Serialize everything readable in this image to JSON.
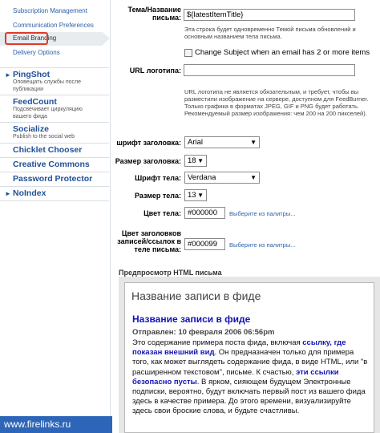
{
  "sidebar": {
    "sub_items": [
      {
        "label": "Subscription Management"
      },
      {
        "label": "Communication Preferences"
      },
      {
        "label": "Email Branding"
      },
      {
        "label": "Delivery Options"
      }
    ],
    "services": [
      {
        "title": "PingShot",
        "desc": "Оповещать службы после публикации"
      },
      {
        "title": "FeedCount",
        "desc": "Подсвечивает циркуляцию вашего фида"
      },
      {
        "title": "Socialize",
        "desc": "Publish to the social web"
      },
      {
        "title": "Chicklet Chooser",
        "desc": ""
      },
      {
        "title": "Creative Commons",
        "desc": ""
      },
      {
        "title": "Password Protector",
        "desc": ""
      },
      {
        "title": "NoIndex",
        "desc": ""
      }
    ]
  },
  "form": {
    "subject_label": "Тема/Название письма:",
    "subject_value": "${latestItemTitle}",
    "subject_help": "Эта строка будет одновременно Темой письма обновлений и основным названием тела письма.",
    "change_subject_label": "Change Subject when an email has 2 or more items",
    "logo_label": "URL логотипа:",
    "logo_value": "",
    "logo_help": "URL логотипа не является обязательным, и требует, чтобы вы разместили изображение на сервере, доступном для FeedBurner. Только графика в форматах JPEG, GIF и PNG будет работать. Рекомендуемый размер изображения: чем 200 на 200 пикселей).",
    "heading_font_label": "шрифт заголовка:",
    "heading_font_value": "Arial",
    "heading_size_label": "Размер заголовка:",
    "heading_size_value": "18",
    "body_font_label": "Шрифт тела:",
    "body_font_value": "Verdana",
    "body_size_label": "Размер тела:",
    "body_size_value": "13",
    "body_color_label": "Цвет тела:",
    "body_color_value": "#000000",
    "body_color_link": "Выберите из палитры...",
    "link_color_label": "Цвет заголовков записей/ссылок в теле письма:",
    "link_color_value": "#000099",
    "link_color_link": "Выберите из палитры..."
  },
  "preview": {
    "section_title": "Предпросмотр HTML письма",
    "feed_name": "Название записи в фиде",
    "post_title": "Название записи в фиде",
    "post_date": "Отправлен: 10 февраля 2006 06:56pm",
    "body_1": "Это содержание примера поста фида, включая ",
    "link_1": "ссылку, где показан внешний вид",
    "body_2": ". Он предназначен только для примера того, как может выглядеть содержание фида, в виде HTML, или \"в расширенном текстовом\", письме. К счастью, ",
    "link_2": "эти ссылки безопасно пусты",
    "body_3": ". В ярком, сияющем будущем Электронные подписки, вероятно, будут включать первый пост из вашего фида здесь в качестве примера. До этого времени, визуализируйте здесь свои броские слова, и будьте счастливы."
  },
  "watermark": "www.firelinks.ru",
  "colors": {
    "link": "#2b5fa8",
    "service_title": "#1f4f98",
    "highlight": "#e03a2a",
    "post_link": "#1414b4"
  }
}
